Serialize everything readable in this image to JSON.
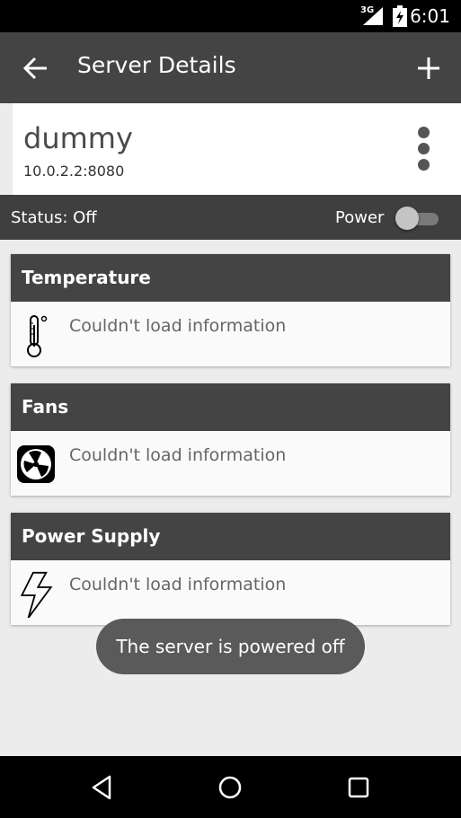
{
  "status_bar": {
    "network": "3G",
    "time": "6:01"
  },
  "app_bar": {
    "title": "Server Details",
    "back_icon": "arrow-back-icon",
    "add_icon": "plus-icon"
  },
  "server": {
    "name": "dummy",
    "address": "10.0.2.2:8080",
    "menu_icon": "overflow-menu-icon"
  },
  "status_strip": {
    "status": "Status: Off",
    "power_label": "Power",
    "power_on": false
  },
  "cards": [
    {
      "title": "Temperature",
      "message": "Couldn't load information",
      "icon": "thermometer-icon"
    },
    {
      "title": "Fans",
      "message": "Couldn't load information",
      "icon": "fan-icon"
    },
    {
      "title": "Power Supply",
      "message": "Couldn't load information",
      "icon": "lightning-icon"
    }
  ],
  "toast": {
    "message": "The server is powered off"
  },
  "nav_bar": {
    "back_icon": "nav-back-icon",
    "home_icon": "nav-home-icon",
    "recents_icon": "nav-recents-icon"
  },
  "colors": {
    "app_bar": "#444444",
    "status_strip": "#3f3f3f",
    "background": "#ececec",
    "toast": "#5a5a5a"
  }
}
